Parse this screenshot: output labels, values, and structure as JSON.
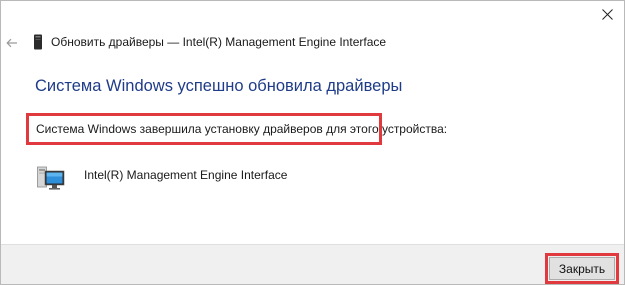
{
  "window": {
    "caption": "Обновить драйверы — Intel(R) Management Engine Interface",
    "close_icon": "close-icon",
    "back_icon": "back-arrow-icon"
  },
  "main": {
    "heading": "Система Windows успешно обновила драйверы",
    "status": "Система Windows завершила установку драйверов для этого устройства:",
    "device": {
      "name": "Intel(R) Management Engine Interface",
      "icon": "computer-device-icon"
    }
  },
  "footer": {
    "close_label": "Закрыть"
  },
  "colors": {
    "heading": "#1f3c88",
    "highlight": "#e0393e",
    "footer_bg": "#f0f0f0"
  }
}
